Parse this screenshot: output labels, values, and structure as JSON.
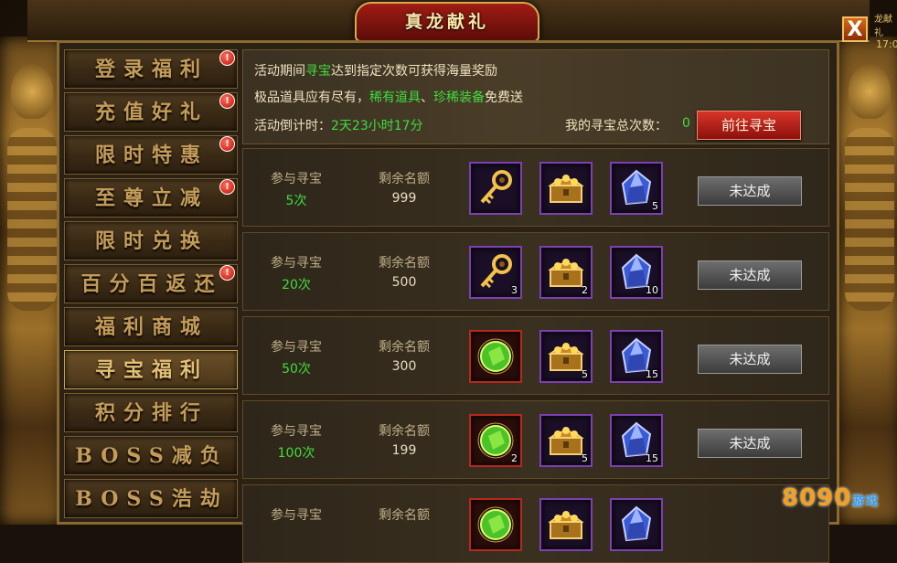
{
  "window": {
    "title": "真龙献礼",
    "close_label": "X",
    "corner_text": "龙献礼",
    "corner_time": "17:0"
  },
  "sidebar": {
    "items": [
      {
        "label": "登录福利",
        "badge": "!"
      },
      {
        "label": "充值好礼",
        "badge": "!"
      },
      {
        "label": "限时特惠",
        "badge": "!"
      },
      {
        "label": "至尊立减",
        "badge": "!"
      },
      {
        "label": "限时兑换",
        "badge": ""
      },
      {
        "label": "百分百返还",
        "badge": "!"
      },
      {
        "label": "福利商城",
        "badge": ""
      },
      {
        "label": "寻宝福利",
        "badge": "",
        "active": true
      },
      {
        "label": "积分排行",
        "badge": ""
      },
      {
        "label": "BOSS减负",
        "badge": ""
      },
      {
        "label": "BOSS浩劫",
        "badge": ""
      }
    ]
  },
  "info": {
    "line1_pre": "活动期间",
    "line1_hl": "寻宝",
    "line1_post": "达到指定次数可获得海量奖励",
    "line2_pre": "极品道具应有尽有，",
    "line2_hl1": "稀有道具",
    "line2_sep": "、",
    "line2_hl2": "珍稀装备",
    "line2_post": "免费送",
    "countdown_label": "活动倒计时：",
    "countdown_value": "2天23小时17分",
    "total_label": "我的寻宝总次数：",
    "total_value": "0",
    "go_button": "前往寻宝"
  },
  "rewards": {
    "col1_label": "参与寻宝",
    "col2_label": "剩余名额",
    "status_label": "未达成",
    "rows": [
      {
        "times": "5次",
        "remaining": "999",
        "items": [
          {
            "icon": "golden-key-icon",
            "qty": "",
            "frame": "purple"
          },
          {
            "icon": "treasure-chest-icon",
            "qty": "",
            "frame": "purple"
          },
          {
            "icon": "blue-gem-icon",
            "qty": "5",
            "frame": "purple"
          }
        ]
      },
      {
        "times": "20次",
        "remaining": "500",
        "items": [
          {
            "icon": "golden-key-icon",
            "qty": "3",
            "frame": "purple"
          },
          {
            "icon": "treasure-chest-icon",
            "qty": "2",
            "frame": "purple"
          },
          {
            "icon": "blue-gem-icon",
            "qty": "10",
            "frame": "purple"
          }
        ]
      },
      {
        "times": "50次",
        "remaining": "300",
        "items": [
          {
            "icon": "green-gem-icon",
            "qty": "",
            "frame": "red"
          },
          {
            "icon": "treasure-chest-icon",
            "qty": "5",
            "frame": "purple"
          },
          {
            "icon": "blue-gem-icon",
            "qty": "15",
            "frame": "purple"
          }
        ]
      },
      {
        "times": "100次",
        "remaining": "199",
        "items": [
          {
            "icon": "green-gem-icon",
            "qty": "2",
            "frame": "red"
          },
          {
            "icon": "treasure-chest-icon",
            "qty": "5",
            "frame": "purple"
          },
          {
            "icon": "blue-gem-icon",
            "qty": "15",
            "frame": "purple"
          }
        ]
      },
      {
        "times": "",
        "remaining": "",
        "items": [
          {
            "icon": "green-gem-icon",
            "qty": "",
            "frame": "red"
          },
          {
            "icon": "treasure-chest-icon",
            "qty": "",
            "frame": "purple"
          },
          {
            "icon": "blue-gem-icon",
            "qty": "",
            "frame": "purple"
          }
        ]
      }
    ]
  },
  "watermark": {
    "main": "8090",
    "sub": "游戏"
  },
  "colors": {
    "highlight": "#3fdc3f",
    "gold": "#c49c5a",
    "button_red": "#c4241a"
  }
}
